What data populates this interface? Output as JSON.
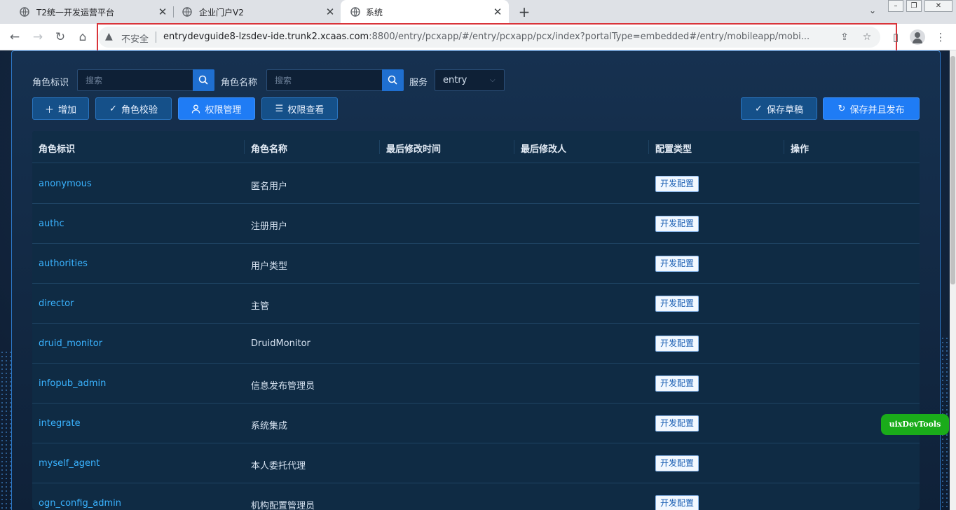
{
  "browser": {
    "tabs": [
      {
        "title": "T2统一开发运营平台",
        "active": false
      },
      {
        "title": "企业门户V2",
        "active": false
      },
      {
        "title": "系统",
        "active": true
      }
    ],
    "address": {
      "security_label": "不安全",
      "host": "entrydevguide8-lzsdev-ide.trunk2.xcaas.com",
      "path": ":8800/entry/pcxapp/#/entry/pcxapp/pcx/index?portalType=embedded#/entry/mobileapp/mobi..."
    }
  },
  "filters": {
    "role_id_label": "角色标识",
    "role_id_placeholder": "搜索",
    "role_name_label": "角色名称",
    "role_name_placeholder": "搜索",
    "service_label": "服务",
    "service_value": "entry"
  },
  "actions": {
    "add": "增加",
    "role_check": "角色校验",
    "permission_manage": "权限管理",
    "permission_view": "权限查看",
    "save_draft": "保存草稿",
    "save_publish": "保存并且发布"
  },
  "table": {
    "columns": [
      "角色标识",
      "角色名称",
      "最后修改时间",
      "最后修改人",
      "配置类型",
      "操作"
    ],
    "rows": [
      {
        "id": "anonymous",
        "name": "匿名用户",
        "type": "开发配置"
      },
      {
        "id": "authc",
        "name": "注册用户",
        "type": "开发配置"
      },
      {
        "id": "authorities",
        "name": "用户类型",
        "type": "开发配置"
      },
      {
        "id": "director",
        "name": "主管",
        "type": "开发配置"
      },
      {
        "id": "druid_monitor",
        "name": "DruidMonitor",
        "type": "开发配置"
      },
      {
        "id": "infopub_admin",
        "name": "信息发布管理员",
        "type": "开发配置"
      },
      {
        "id": "integrate",
        "name": "系统集成",
        "type": "开发配置"
      },
      {
        "id": "myself_agent",
        "name": "本人委托代理",
        "type": "开发配置"
      },
      {
        "id": "ogn_config_admin",
        "name": "机构配置管理员",
        "type": "开发配置"
      }
    ]
  },
  "devtools": {
    "label": "uixDevTools"
  },
  "colors": {
    "accent": "#1f7cf5",
    "link": "#3ab3ff",
    "highlight": "#d9343a"
  }
}
